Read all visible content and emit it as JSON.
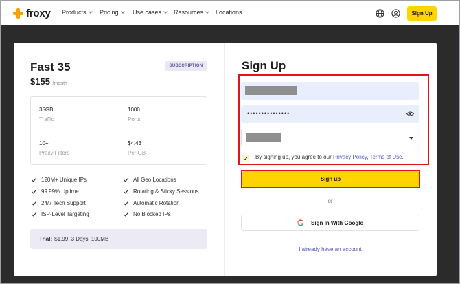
{
  "nav": {
    "brand": "froxy",
    "links": [
      {
        "label": "Products",
        "dropdown": true
      },
      {
        "label": "Pricing",
        "dropdown": true
      },
      {
        "label": "Use cases",
        "dropdown": true
      },
      {
        "label": "Resources",
        "dropdown": true
      },
      {
        "label": "Locations",
        "dropdown": false
      }
    ],
    "signup_label": "Sign Up",
    "icons": [
      "globe-icon",
      "user-icon"
    ]
  },
  "plan": {
    "title": "Fast 35",
    "badge": "SUBSCRIPTION",
    "price": "$155",
    "period": "/month",
    "stats": [
      {
        "value": "35GB",
        "label": "Traffic"
      },
      {
        "value": "1000",
        "label": "Ports"
      },
      {
        "value": "10+",
        "label": "Proxy Filters"
      },
      {
        "value": "$4.43",
        "label": "Per GB"
      }
    ],
    "features": [
      "120M+ Unique IPs",
      "All Geo Locations",
      "99.99% Uptime",
      "Rotating & Sticky Sessions",
      "24/7 Tech Support",
      "Automatic Rotation",
      "ISP-Level Targeting",
      "No Blocked IPs"
    ],
    "trial_label": "Trial:",
    "trial_text": "$1.99, 3 Days, 100MB"
  },
  "form": {
    "title": "Sign Up",
    "password_value": "•••••••••••••••",
    "agree_prefix": "By signing up, you agree to our ",
    "privacy_link": "Privacy Policy",
    "separator": ", ",
    "terms_link": "Terms of Use",
    "agree_suffix": ".",
    "agreed": true,
    "submit_label": "Sign up",
    "or_label": "or",
    "google_label": "Sign In With Google",
    "login_link": "I already have an account"
  },
  "colors": {
    "accent_yellow": "#ffd400",
    "brand_orange": "#f5a300",
    "link_purple": "#5656c2",
    "highlight_red": "#e0141e",
    "input_fill": "#e8eefb"
  }
}
